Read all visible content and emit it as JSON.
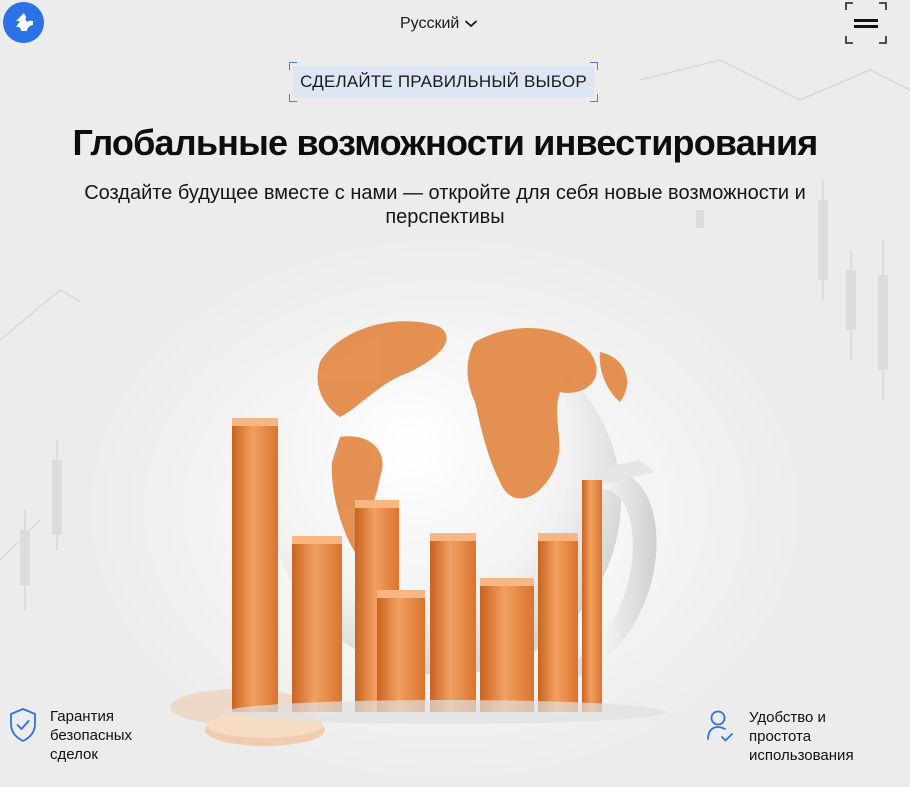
{
  "header": {
    "logo_icon": "brand-logo-icon",
    "language": {
      "label": "Русский",
      "icon": "chevron-down-icon"
    },
    "menu_icon": "hamburger-menu-icon"
  },
  "hero": {
    "eyebrow": "СДЕЛАЙТЕ ПРАВИЛЬНЫЙ ВЫБОР",
    "title": "Глобальные возможности инвестирования",
    "subtitle_line1": "Создайте будущее вместе с нами — откройте для себя новые возможности и",
    "subtitle_line2": "перспективы",
    "image": "globe-with-orange-bar-chart-illustration"
  },
  "features": [
    {
      "icon": "shield-check-icon",
      "label": "Гарантия\nбезопасных\nсделок"
    },
    {
      "icon": "user-check-icon",
      "label": "Удобство и\nпростота\nиспользования"
    }
  ],
  "colors": {
    "accent": "#2b72e6",
    "eyebrow_bg": "#dde6f5",
    "orange": "#e8843c",
    "background": "#ececec"
  }
}
